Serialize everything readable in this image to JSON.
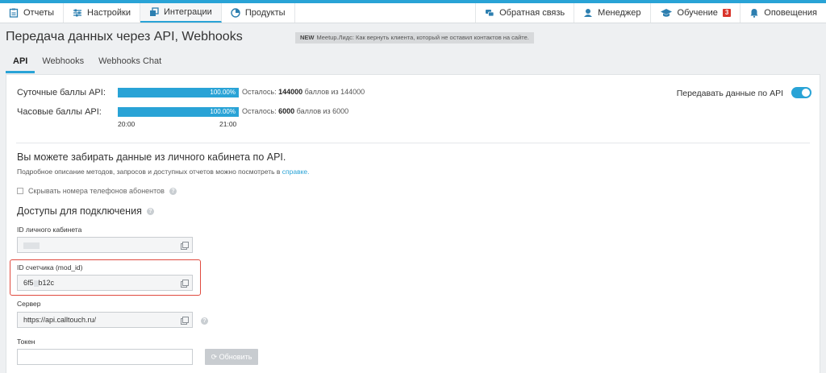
{
  "nav": {
    "left": [
      {
        "label": "Отчеты",
        "icon": "report-icon"
      },
      {
        "label": "Настройки",
        "icon": "settings-icon"
      },
      {
        "label": "Интеграции",
        "icon": "integrations-icon"
      },
      {
        "label": "Продукты",
        "icon": "products-icon"
      }
    ],
    "right": [
      {
        "label": "Обратная связь",
        "icon": "feedback-icon"
      },
      {
        "label": "Менеджер",
        "icon": "manager-icon"
      },
      {
        "label": "Обучение",
        "icon": "education-icon",
        "badge": "3"
      },
      {
        "label": "Оповещения",
        "icon": "bell-icon"
      }
    ]
  },
  "header": {
    "title": "Передача данных через API, Webhooks",
    "news_tag": "NEW",
    "news_text": "Meetup.Лидс: Как вернуть клиента, который не оставил контактов на сайте."
  },
  "tabs": [
    "API",
    "Webhooks",
    "Webhooks Chat"
  ],
  "quota": {
    "daily_label": "Суточные баллы API:",
    "daily_percent": "100.00%",
    "daily_fill": 1.0,
    "daily_note_prefix": "Осталось:",
    "daily_remaining": "144000",
    "daily_note_suffix": "баллов из 144000",
    "hourly_label": "Часовые баллы API:",
    "hourly_percent": "100.00%",
    "hourly_fill": 1.0,
    "hourly_note_prefix": "Осталось:",
    "hourly_remaining": "6000",
    "hourly_note_suffix": "баллов из 6000",
    "time_start": "20:00",
    "time_end": "21:00"
  },
  "send": {
    "label": "Передавать данные по API",
    "enabled": true
  },
  "info": {
    "heading": "Вы можете забирать данные из личного кабинета по API.",
    "desc_prefix": "Подробное описание методов, запросов и доступных отчетов можно посмотреть в",
    "desc_link": "справке."
  },
  "hide_phones_label": "Скрывать номера телефонов абонентов",
  "access": {
    "heading": "Доступы для подключения",
    "account_id_label": "ID личного кабинета",
    "account_id_value": "",
    "counter_id_label": "ID счетчика (mod_id)",
    "counter_id_value_start": "6f5",
    "counter_id_value_end": "b12c",
    "server_label": "Сервер",
    "server_value": "https://api.calltouch.ru/",
    "token_label": "Токен",
    "token_value": "",
    "refresh_label": "Обновить"
  },
  "colors": {
    "accent": "#29a3d6",
    "highlight": "#e04a3f",
    "badge": "#d9342b"
  }
}
